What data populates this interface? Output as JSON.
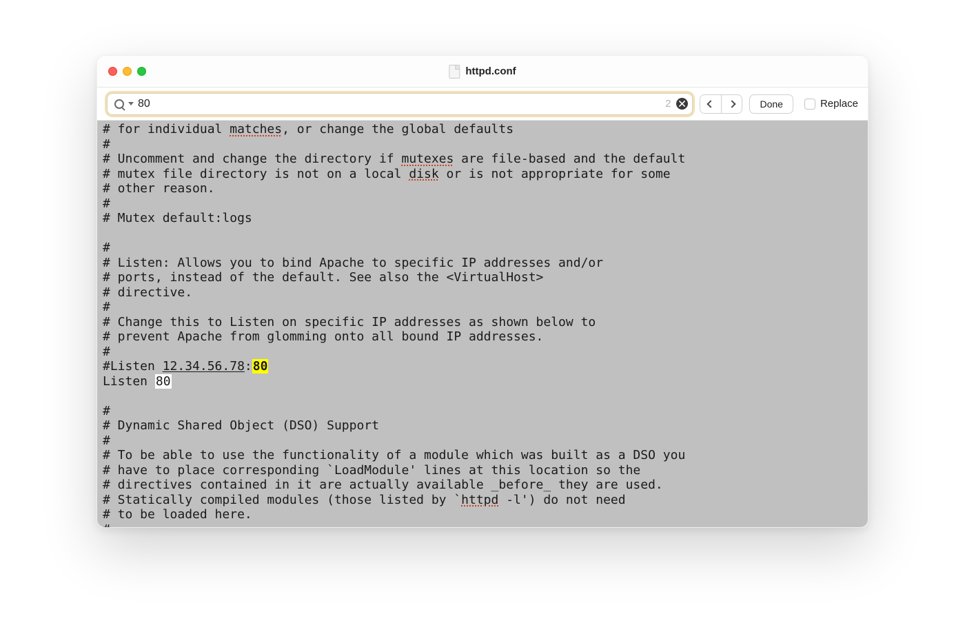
{
  "titlebar": {
    "filename": "httpd.conf"
  },
  "findbar": {
    "query": "80",
    "match_count": "2",
    "done_label": "Done",
    "replace_label": "Replace"
  },
  "editor": {
    "lines": [
      "# for individual ~matches~, or change the global defaults",
      "#",
      "# Uncomment and change the directory if ~mutexes~ are file-based and the default",
      "# mutex file directory is not on a local ~disk~ or is not appropriate for some",
      "# other reason.",
      "#",
      "# Mutex default:logs",
      "",
      "#",
      "# Listen: Allows you to bind Apache to specific IP addresses and/or",
      "# ports, instead of the default. See also the <VirtualHost>",
      "# directive.",
      "#",
      "# Change this to Listen on specific IP addresses as shown below to",
      "# prevent Apache from glomming onto all bound IP addresses.",
      "#",
      "#Listen ^12.34.56.78^:⟦80⟧",
      "Listen ⟪80⟫",
      "",
      "#",
      "# Dynamic Shared Object (DSO) Support",
      "#",
      "# To be able to use the functionality of a module which was built as a DSO you",
      "# have to place corresponding `LoadModule' lines at this location so the",
      "# directives contained in it are actually available _before_ they are used.",
      "# Statically compiled modules (those listed by `~httpd~ -l') do not need",
      "# to be loaded here.",
      "#"
    ]
  }
}
